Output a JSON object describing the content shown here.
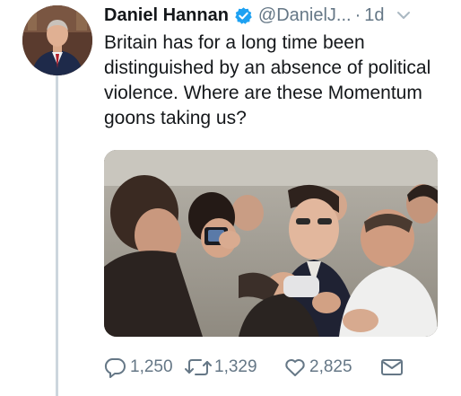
{
  "tweet": {
    "author_name": "Daniel Hannan",
    "handle": "@DanielJ...",
    "separator": "·",
    "time": "1d",
    "text": "Britain has for a long time been distinguished by an absence of political violence. Where are these Momentum goons taking us?",
    "icons": {
      "verified": "verified-badge-icon",
      "more": "chevron-down-icon"
    },
    "colors": {
      "verified": "#1da1f2",
      "secondary_text": "#657786",
      "primary_text": "#14171a"
    },
    "actions": {
      "reply_count": "1,250",
      "retweet_count": "1,329",
      "like_count": "2,825"
    }
  }
}
